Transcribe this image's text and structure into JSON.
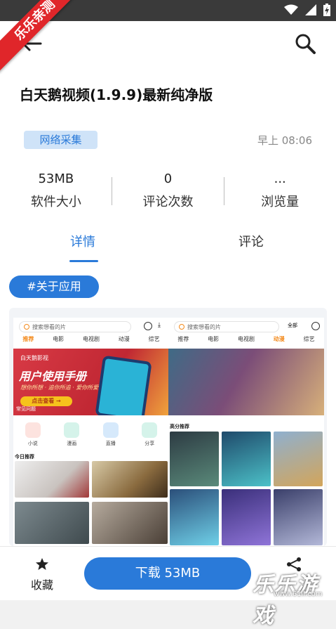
{
  "ribbon": {
    "text": "乐乐亲测"
  },
  "app": {
    "title": "白天鹅视频(1.9.9)最新纯净版"
  },
  "meta": {
    "tag": "网络采集",
    "time": "早上 08:06"
  },
  "stats": [
    {
      "value": "53MB",
      "label": "软件大小"
    },
    {
      "value": "0",
      "label": "评论次数"
    },
    {
      "value": "...",
      "label": "浏览量"
    }
  ],
  "tabs": {
    "detail": "详情",
    "comment": "评论"
  },
  "hashtag": "#关于应用",
  "preview": {
    "left": {
      "search_placeholder": "搜索想看的片",
      "nav": [
        "推荐",
        "电影",
        "电视剧",
        "动漫",
        "综艺"
      ],
      "banner_small": "白天鹅影视",
      "banner_title": "用户使用手册",
      "banner_sub": "想你所想 · 追你所追 · 爱你所爱",
      "banner_btn": "点击查看 →",
      "banner_label": "常见问题",
      "icons": [
        "小说",
        "漫画",
        "直播",
        "分享"
      ],
      "today": "今日推荐"
    },
    "right": {
      "search_placeholder": "搜索想看的片",
      "filter": "全部",
      "nav": [
        "推荐",
        "电影",
        "电视剧",
        "动漫",
        "综艺"
      ],
      "hot": "高分推荐"
    }
  },
  "bottom": {
    "favorite": "收藏",
    "download": "下载 53MB"
  },
  "watermark": {
    "text": "乐乐游戏",
    "url": "www.61ll.com"
  },
  "colors": {
    "accent": "#2a7ad9",
    "ribbon": "#e0262a",
    "statusbar": "#3a3a3a"
  }
}
